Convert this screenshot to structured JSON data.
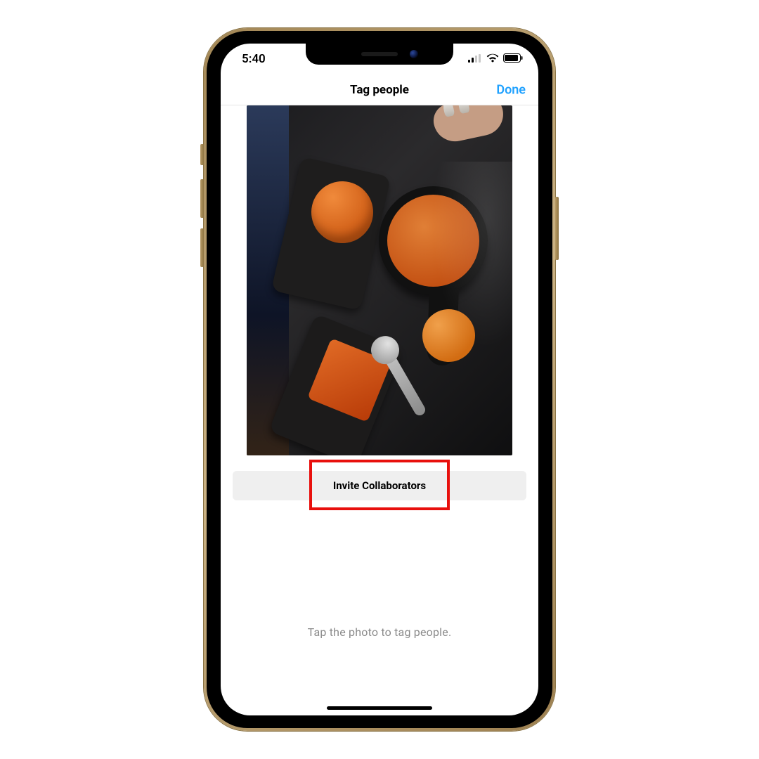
{
  "status_bar": {
    "time": "5:40",
    "cellular_bars": 2,
    "icons": {
      "cellular": "cellular-icon",
      "wifi": "wifi-icon",
      "battery": "battery-icon"
    }
  },
  "nav": {
    "title": "Tag people",
    "done_label": "Done"
  },
  "invite": {
    "label": "Invite Collaborators",
    "highlight_color": "#e8100d"
  },
  "hint": {
    "text": "Tap the photo to tag people."
  },
  "photo": {
    "description": "Top-down food photo on a dark restaurant table: a burger on one slate plate, a skillet pizza with a round bun beside it, and a slate plate with toast and a spoon; a person's sleeve at left and a hand with manicured nails at top-right."
  },
  "colors": {
    "accent_blue": "#1fa1ff",
    "button_bg": "#efefef"
  }
}
